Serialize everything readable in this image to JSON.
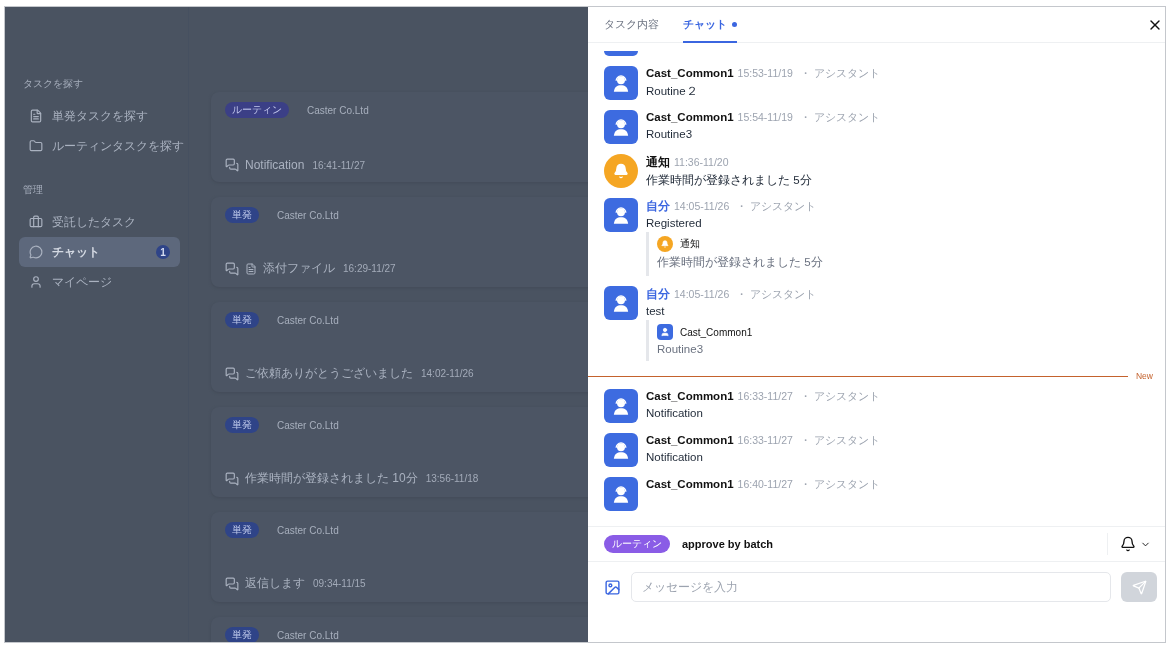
{
  "sidebar": {
    "sections": [
      {
        "heading": "タスクを探す",
        "items": [
          {
            "kind": "file",
            "label": "単発タスクを探す",
            "selected": false
          },
          {
            "kind": "folder",
            "label": "ルーティンタスクを探す",
            "selected": false
          }
        ]
      },
      {
        "heading": "管理",
        "items": [
          {
            "kind": "briefcase",
            "label": "受託したタスク",
            "selected": false
          },
          {
            "kind": "chat",
            "label": "チャット",
            "selected": true,
            "badge": "1"
          },
          {
            "kind": "user",
            "label": "マイページ",
            "selected": false
          }
        ]
      }
    ]
  },
  "task_cards": [
    {
      "tag": "ルーティン",
      "kind": "routine",
      "company": "Caster Co.Ltd",
      "attachment": false,
      "message": "Notification",
      "time": "16:41-11/27"
    },
    {
      "tag": "単発",
      "kind": "single",
      "company": "Caster Co.Ltd",
      "attachment": true,
      "message": "添付ファイル",
      "time": "16:29-11/27"
    },
    {
      "tag": "単発",
      "kind": "single",
      "company": "Caster Co.Ltd",
      "attachment": false,
      "message": "ご依頼ありがとうございました",
      "time": "14:02-11/26"
    },
    {
      "tag": "単発",
      "kind": "single",
      "company": "Caster Co.Ltd",
      "attachment": false,
      "message": "作業時間が登録されました 10分",
      "time": "13:56-11/18"
    },
    {
      "tag": "単発",
      "kind": "single",
      "company": "Caster Co.Ltd",
      "attachment": false,
      "message": "返信します",
      "time": "09:34-11/15"
    },
    {
      "tag": "単発",
      "kind": "single",
      "company": "Caster Co.Ltd"
    }
  ],
  "panel": {
    "tabs": [
      {
        "label": "タスク内容",
        "selected": false,
        "unread": false
      },
      {
        "label": "チャット",
        "selected": true,
        "unread": true
      }
    ],
    "messages": [
      {
        "kind": "user",
        "name": "Cast_Common1",
        "self": false,
        "time": "15:53-11/19",
        "role": "・ アシスタント",
        "body": "Routine２"
      },
      {
        "kind": "user",
        "name": "Cast_Common1",
        "self": false,
        "time": "15:54-11/19",
        "role": "・ アシスタント",
        "body": "Routine3"
      },
      {
        "kind": "notice",
        "name": "通知",
        "self": false,
        "time": "11:36-11/20",
        "body": "作業時間が登録されました 5分"
      },
      {
        "kind": "user",
        "name": "自分",
        "self": true,
        "time": "14:05-11/26",
        "role": "・ アシスタント",
        "body": "Registered",
        "quote": {
          "kind": "notice",
          "name": "通知",
          "body": "作業時間が登録されました 5分"
        }
      },
      {
        "kind": "user",
        "name": "自分",
        "self": true,
        "time": "14:05-11/26",
        "role": "・ アシスタント",
        "body": "test",
        "quote": {
          "kind": "user",
          "name": "Cast_Common1",
          "body": "Routine3"
        }
      },
      {
        "kind": "divider",
        "label": "New"
      },
      {
        "kind": "user",
        "name": "Cast_Common1",
        "self": false,
        "time": "16:33-11/27",
        "role": "・ アシスタント",
        "body": "Notification"
      },
      {
        "kind": "user",
        "name": "Cast_Common1",
        "self": false,
        "time": "16:33-11/27",
        "role": "・ アシスタント",
        "body": "Notification"
      },
      {
        "kind": "user",
        "name": "Cast_Common1",
        "self": false,
        "time": "16:40-11/27",
        "role": "・ アシスタント"
      }
    ],
    "footer": {
      "tag": "ルーティン",
      "kind": "routine",
      "title": "approve by batch"
    },
    "composer": {
      "placeholder": "メッセージを入力",
      "send_enabled": false
    }
  }
}
